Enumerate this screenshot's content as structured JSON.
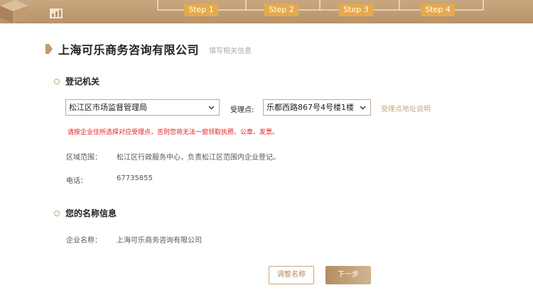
{
  "steps": [
    "Step 1",
    "Step 2",
    "Step 3",
    "Step 4"
  ],
  "header": {
    "title": "上海可乐商务咨询有限公司",
    "subtitle": "填写相关信息"
  },
  "registration": {
    "section_title": "登记机关",
    "authority_selected": "松江区市场监督管理局",
    "acceptance_label": "受理点:",
    "acceptance_selected": "乐都西路867号4号楼1楼",
    "acceptance_link": "受理点地址说明",
    "warning": "请按企业住所选择对应受理点，否则您将无法一窗领取执照、公章、发票。",
    "area_label": "区域范围：",
    "area_value": "松江区行政服务中心，负责松江区范围内企业登记。",
    "phone_label": "电话：",
    "phone_value": "67735855"
  },
  "name_info": {
    "section_title": "您的名称信息",
    "company_label": "企业名称：",
    "company_value": "上海可乐商务咨询有限公司"
  },
  "actions": {
    "adjust_label": "调整名称",
    "next_label": "下一步"
  },
  "colors": {
    "accent": "#c9a77e",
    "step": "#e5a94d",
    "warning": "#e02020"
  }
}
